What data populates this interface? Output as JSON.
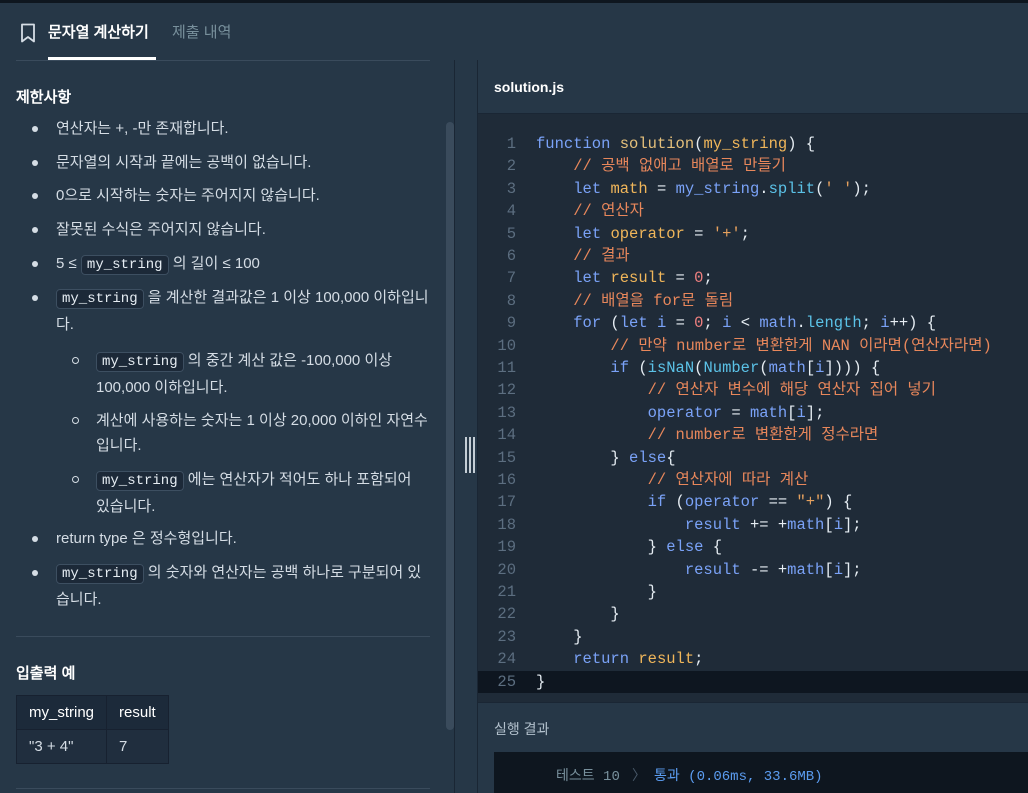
{
  "tabs": {
    "active": "문자열 계산하기",
    "inactive": "제출 내역"
  },
  "restrictions": {
    "title": "제한사항",
    "items": [
      "연산자는 +, -만 존재합니다.",
      "문자열의 시작과 끝에는 공백이 없습니다.",
      "0으로 시작하는 숫자는 주어지지 않습니다.",
      "잘못된 수식은 주어지지 않습니다."
    ],
    "item5": {
      "pre": "5 ≤ ",
      "code": "my_string",
      "post": " 의 길이 ≤ 100"
    },
    "item6": {
      "code": "my_string",
      "post": " 을 계산한 결과값은 1 이상 100,000 이하입니다."
    },
    "sub1": {
      "code": "my_string",
      "post": " 의 중간 계산 값은 -100,000 이상 100,000 이하입니다."
    },
    "sub2": "계산에 사용하는 숫자는 1 이상 20,000 이하인 자연수입니다.",
    "sub3": {
      "code": "my_string",
      "post": " 에는 연산자가 적어도 하나 포함되어 있습니다."
    },
    "item7": "return type 은 정수형입니다.",
    "item8": {
      "code": "my_string",
      "post": " 의 숫자와 연산자는 공백 하나로 구분되어 있습니다."
    }
  },
  "io_example": {
    "title": "입출력 예",
    "headers": [
      "my_string",
      "result"
    ],
    "rows": [
      [
        "\"3 + 4\"",
        "7"
      ]
    ]
  },
  "editor": {
    "filename": "solution.js",
    "active_line": 25
  },
  "result": {
    "title": "실행 결과",
    "label": "테스트 10",
    "arrow": "〉",
    "value": "통과 (0.06ms, 33.6MB)"
  }
}
